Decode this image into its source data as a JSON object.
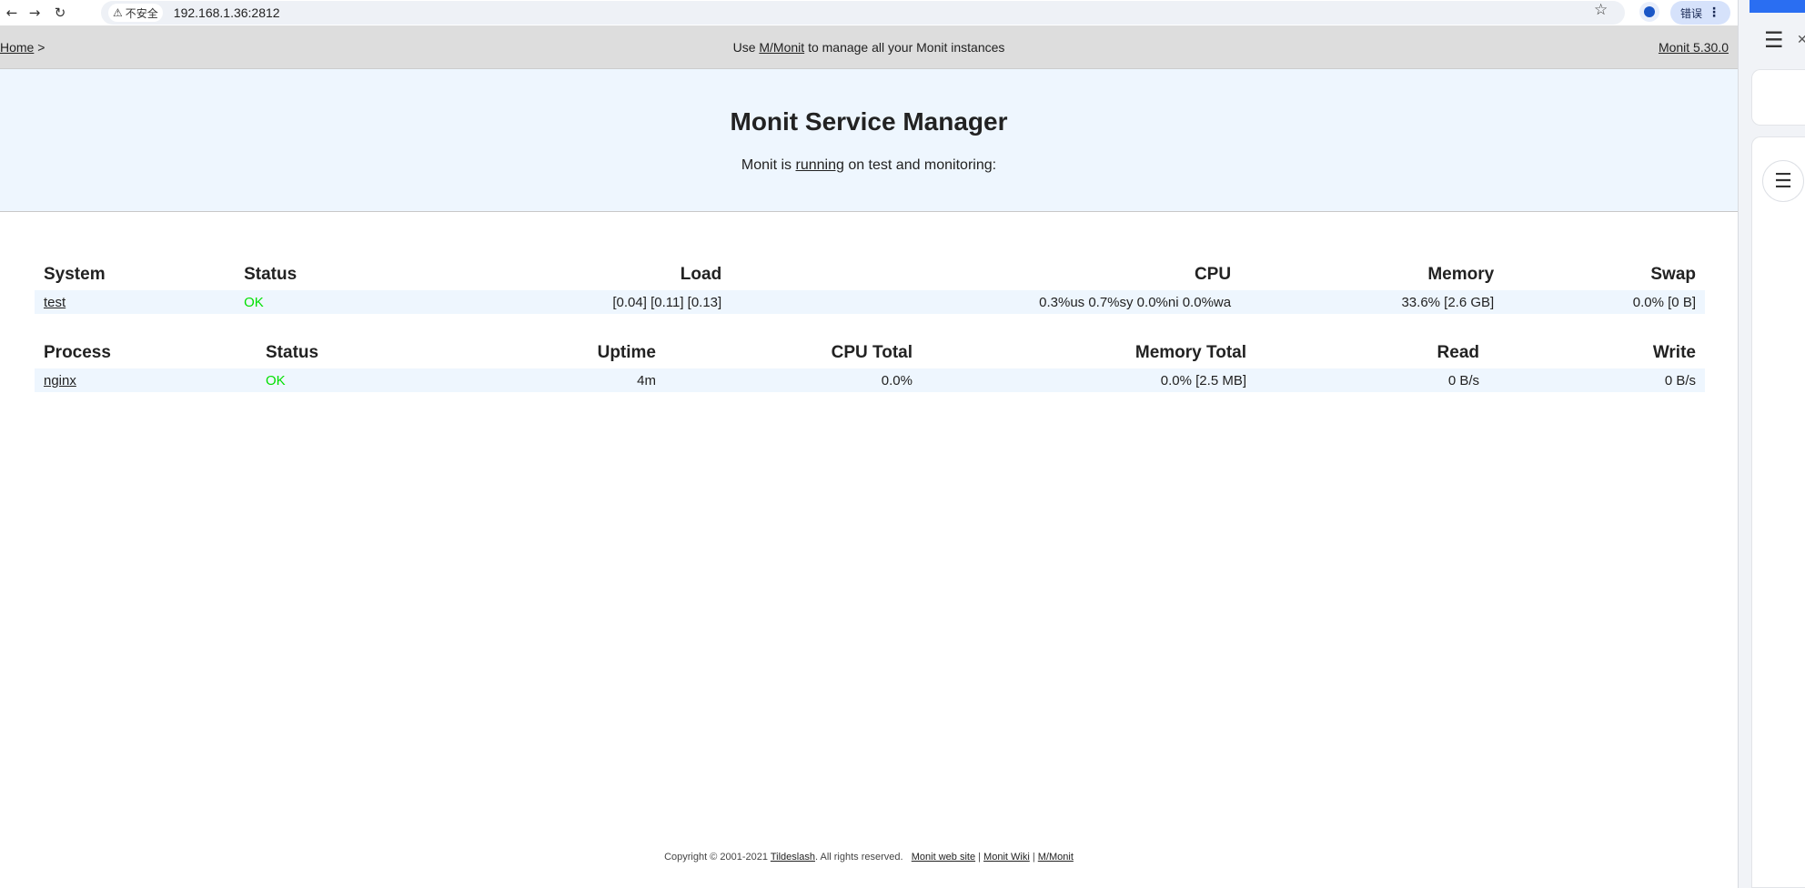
{
  "browser": {
    "security_label": "不安全",
    "url": "192.168.1.36:2812",
    "error_label": "错误"
  },
  "topnav": {
    "home_link": "Home",
    "crumb_sep": ">",
    "center_prefix": "Use",
    "mmonit_link": "M/Monit",
    "center_suffix": "to manage all your Monit instances",
    "version_link": "Monit 5.30.0"
  },
  "hero": {
    "title": "Monit Service Manager",
    "status_prefix": "Monit is",
    "status_link": "running",
    "status_suffix": "on test and monitoring:"
  },
  "system_table": {
    "headers": [
      "System",
      "Status",
      "Load",
      "CPU",
      "Memory",
      "Swap"
    ],
    "row": {
      "name": "test",
      "status": "OK",
      "load": "[0.04] [0.11] [0.13]",
      "cpu": "0.3%us 0.7%sy 0.0%ni 0.0%wa",
      "memory": "33.6% [2.6 GB]",
      "swap": "0.0% [0 B]"
    }
  },
  "process_table": {
    "headers": [
      "Process",
      "Status",
      "Uptime",
      "CPU Total",
      "Memory Total",
      "Read",
      "Write"
    ],
    "row": {
      "name": "nginx",
      "status": "OK",
      "uptime": "4m",
      "cpu_total": "0.0%",
      "memory_total": "0.0% [2.5 MB]",
      "read": "0 B/s",
      "write": "0 B/s"
    }
  },
  "footer": {
    "copyright": "Copyright © 2001-2021",
    "company_link": "Tildeslash",
    "rights": ". All rights reserved.",
    "website_link": "Monit web site",
    "wiki_link": "Monit Wiki",
    "mmonit_link": "M/Monit",
    "sep": "|"
  },
  "colors": {
    "ok": "#00e000",
    "hero_bg": "#eef6fe",
    "topnav_bg": "#dddddd"
  }
}
